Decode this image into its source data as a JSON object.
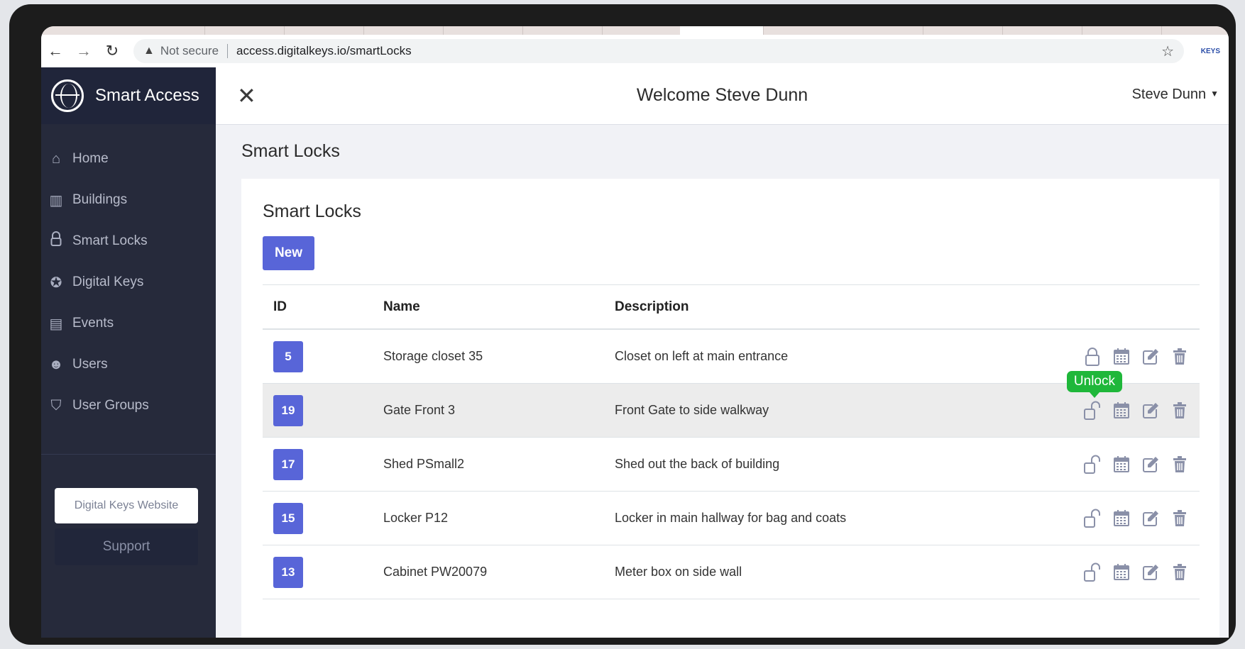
{
  "browser": {
    "security_label": "Not secure",
    "url": "access.digitalkeys.io/smartLocks",
    "extension_label": "KEYS"
  },
  "sidebar": {
    "brand": "Smart Access",
    "items": [
      {
        "label": "Home",
        "icon": "home-icon"
      },
      {
        "label": "Buildings",
        "icon": "building-icon"
      },
      {
        "label": "Smart Locks",
        "icon": "lock-icon"
      },
      {
        "label": "Digital Keys",
        "icon": "key-badge-icon"
      },
      {
        "label": "Events",
        "icon": "calendar-icon"
      },
      {
        "label": "Users",
        "icon": "users-icon"
      },
      {
        "label": "User Groups",
        "icon": "shield-icon"
      }
    ],
    "website_button": "Digital Keys Website",
    "support_button": "Support"
  },
  "header": {
    "welcome": "Welcome Steve Dunn",
    "user_menu": "Steve Dunn"
  },
  "page": {
    "title": "Smart Locks",
    "card_title": "Smart Locks",
    "new_button": "New"
  },
  "table": {
    "columns": [
      "ID",
      "Name",
      "Description"
    ],
    "rows": [
      {
        "id": "5",
        "name": "Storage closet 35",
        "description": "Closet on left at main entrance",
        "locked": true
      },
      {
        "id": "19",
        "name": "Gate Front 3",
        "description": "Front Gate to side walkway",
        "locked": false
      },
      {
        "id": "17",
        "name": "Shed PSmall2",
        "description": "Shed out the back of building",
        "locked": false
      },
      {
        "id": "15",
        "name": "Locker P12",
        "description": "Locker in main hallway for bag and coats",
        "locked": false
      },
      {
        "id": "13",
        "name": "Cabinet PW20079",
        "description": "Meter box on side wall",
        "locked": false
      }
    ],
    "tooltip": "Unlock"
  },
  "colors": {
    "accent": "#5865d8",
    "sidebar_bg": "#262a3b",
    "tooltip": "#1fb73a"
  }
}
